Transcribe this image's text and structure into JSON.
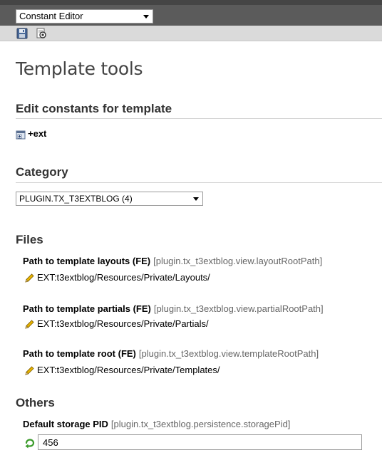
{
  "header": {
    "function_menu": {
      "selected": "Constant Editor"
    },
    "toolbar": {
      "save_icon": "save-icon",
      "view_icon": "view-icon"
    }
  },
  "page_title": "Template tools",
  "edit_section": {
    "heading": "Edit constants for template",
    "template_label": "+ext"
  },
  "category": {
    "heading": "Category",
    "selected": "PLUGIN.TX_T3EXTBLOG (4)"
  },
  "files": {
    "heading": "Files",
    "constants": [
      {
        "label": "Path to template layouts (FE)",
        "key": "[plugin.tx_t3extblog.view.layoutRootPath]",
        "value": "EXT:t3extblog/Resources/Private/Layouts/"
      },
      {
        "label": "Path to template partials (FE)",
        "key": "[plugin.tx_t3extblog.view.partialRootPath]",
        "value": "EXT:t3extblog/Resources/Private/Partials/"
      },
      {
        "label": "Path to template root (FE)",
        "key": "[plugin.tx_t3extblog.view.templateRootPath]",
        "value": "EXT:t3extblog/Resources/Private/Templates/"
      }
    ]
  },
  "others": {
    "heading": "Others",
    "constant": {
      "label": "Default storage PID",
      "key": "[plugin.tx_t3extblog.persistence.storagePid]",
      "value": "456"
    }
  },
  "colors": {
    "topbar": "#5b5b5b",
    "toolbar": "#dadada",
    "pencil": "#e8b400",
    "undo": "#3a9a2a"
  }
}
